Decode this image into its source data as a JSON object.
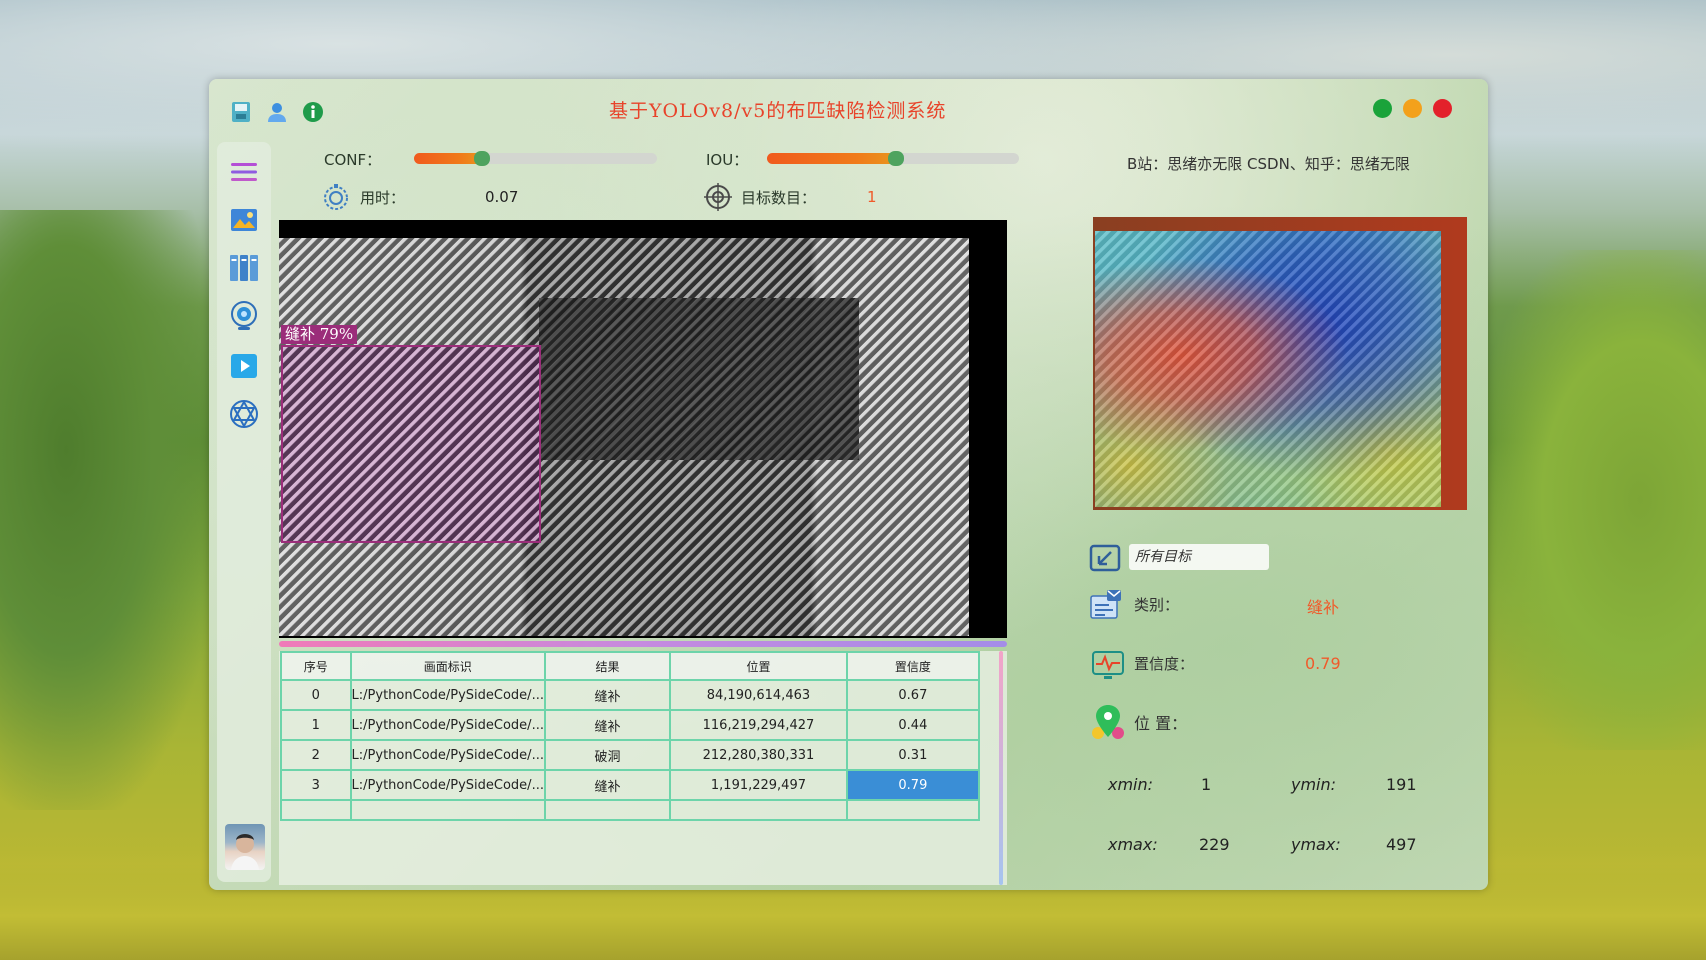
{
  "app": {
    "title": "基于YOLOv8/v5的布匹缺陷检测系统",
    "credit": "B站：思绪亦无限  CSDN、知乎：思绪无限"
  },
  "window_controls": {
    "colors": [
      "#1aa33a",
      "#f3a11b",
      "#e3212b"
    ]
  },
  "title_icons": [
    "save-icon",
    "user-icon",
    "info-icon"
  ],
  "sidebar": {
    "items": [
      "menu-icon",
      "image-icon",
      "folder-batch-icon",
      "camera-icon",
      "video-icon",
      "model-icon"
    ]
  },
  "params": {
    "conf_label": "CONF：",
    "conf_value": 0.28,
    "iou_label": "IOU：",
    "iou_value": 0.51,
    "time_label": "用时：",
    "time_value": "0.07",
    "count_label": "目标数目：",
    "count_value": "1"
  },
  "detection_label": "缝补  79%",
  "table": {
    "headers": [
      "序号",
      "画面标识",
      "结果",
      "位置",
      "置信度"
    ],
    "rows": [
      [
        "0",
        "L:/PythonCode/PySideCode/...",
        "缝补",
        "84,190,614,463",
        "0.67"
      ],
      [
        "1",
        "L:/PythonCode/PySideCode/...",
        "缝补",
        "116,219,294,427",
        "0.44"
      ],
      [
        "2",
        "L:/PythonCode/PySideCode/...",
        "破洞",
        "212,280,380,331",
        "0.31"
      ],
      [
        "3",
        "L:/PythonCode/PySideCode/...",
        "缝补",
        "1,191,229,497",
        "0.79"
      ]
    ]
  },
  "details": {
    "target_select": "所有目标",
    "class_label": "类别：",
    "class_value": "缝补",
    "conf_label": "置信度：",
    "conf_value": "0.79",
    "pos_label": "位  置：",
    "xmin_label": "xmin:",
    "xmin": "1",
    "ymin_label": "ymin:",
    "ymin": "191",
    "xmax_label": "xmax:",
    "xmax": "229",
    "ymax_label": "ymax:",
    "ymax": "497"
  }
}
